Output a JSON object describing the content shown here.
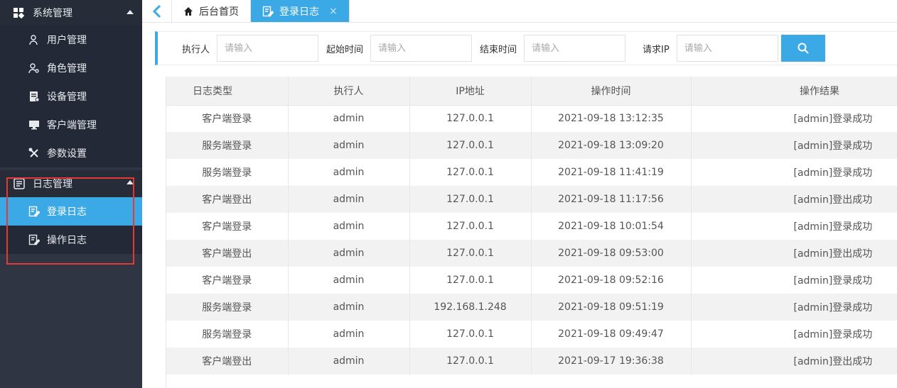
{
  "sidebar": {
    "group_system": "系统管理",
    "items": [
      {
        "label": "用户管理",
        "icon": "user-icon"
      },
      {
        "label": "角色管理",
        "icon": "role-icon"
      },
      {
        "label": "设备管理",
        "icon": "device-icon"
      },
      {
        "label": "客户端管理",
        "icon": "monitor-icon"
      },
      {
        "label": "参数设置",
        "icon": "tools-icon"
      }
    ],
    "group_log": "日志管理",
    "log_items": [
      {
        "label": "登录日志",
        "icon": "edit-icon",
        "active": true
      },
      {
        "label": "操作日志",
        "icon": "edit-icon",
        "active": false
      }
    ]
  },
  "tabs": [
    {
      "label": "后台首页",
      "icon": "home-icon",
      "active": false
    },
    {
      "label": "登录日志",
      "icon": "edit-icon",
      "active": true,
      "close": "×"
    }
  ],
  "filter": {
    "executor_label": "执行人",
    "start_label": "起始时间",
    "end_label": "结束时间",
    "ip_label": "请求IP",
    "placeholder": "请输入"
  },
  "table": {
    "headers": [
      "日志类型",
      "执行人",
      "IP地址",
      "操作时间",
      "操作结果"
    ],
    "rows": [
      [
        "客户端登录",
        "admin",
        "127.0.0.1",
        "2021-09-18 13:12:35",
        "[admin]登录成功"
      ],
      [
        "服务端登录",
        "admin",
        "127.0.0.1",
        "2021-09-18 13:09:20",
        "[admin]登录成功"
      ],
      [
        "服务端登录",
        "admin",
        "127.0.0.1",
        "2021-09-18 11:41:19",
        "[admin]登录成功"
      ],
      [
        "客户端登出",
        "admin",
        "127.0.0.1",
        "2021-09-18 11:17:56",
        "[admin]登出成功"
      ],
      [
        "客户端登录",
        "admin",
        "127.0.0.1",
        "2021-09-18 10:01:54",
        "[admin]登录成功"
      ],
      [
        "客户端登出",
        "admin",
        "127.0.0.1",
        "2021-09-18 09:53:00",
        "[admin]登出成功"
      ],
      [
        "客户端登录",
        "admin",
        "127.0.0.1",
        "2021-09-18 09:52:16",
        "[admin]登录成功"
      ],
      [
        "服务端登录",
        "admin",
        "192.168.1.248",
        "2021-09-18 09:51:19",
        "[admin]登录成功"
      ],
      [
        "服务端登录",
        "admin",
        "127.0.0.1",
        "2021-09-18 09:49:47",
        "[admin]登录成功"
      ],
      [
        "客户端登出",
        "admin",
        "127.0.0.1",
        "2021-09-17 19:36:38",
        "[admin]登出成功"
      ]
    ]
  },
  "colors": {
    "accent": "#3aa9e6",
    "sidebar_bg": "#2f3542",
    "highlight": "#e53935"
  }
}
